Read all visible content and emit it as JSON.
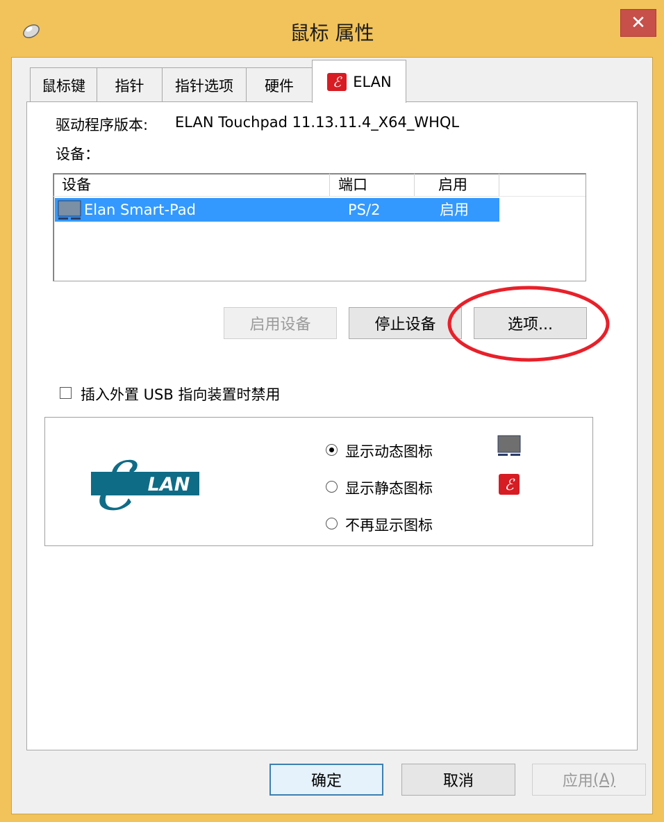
{
  "window": {
    "title": "鼠标 属性",
    "close_symbol": "✕"
  },
  "tabs": [
    {
      "label": "鼠标键"
    },
    {
      "label": "指针"
    },
    {
      "label": "指针选项"
    },
    {
      "label": "硬件"
    },
    {
      "label": "ELAN",
      "active": true
    }
  ],
  "driver": {
    "label": "驱动程序版本:",
    "value": "ELAN Touchpad 11.13.11.4_X64_WHQL"
  },
  "devices_label": "设备：",
  "device_list": {
    "columns": [
      "设备",
      "端口",
      "启用"
    ],
    "rows": [
      {
        "device": "Elan Smart-Pad",
        "port": "PS/2",
        "enabled": "启用",
        "selected": true
      }
    ]
  },
  "device_buttons": {
    "enable": "启用设备",
    "stop": "停止设备",
    "options": "选项..."
  },
  "usb_disable": {
    "label": "插入外置 USB 指向装置时禁用",
    "checked": false
  },
  "icon_options": [
    {
      "label": "显示动态图标",
      "selected": true
    },
    {
      "label": "显示静态图标",
      "selected": false
    },
    {
      "label": "不再显示图标",
      "selected": false
    }
  ],
  "logo": {
    "text": "LAN",
    "color": "#0f6c86"
  },
  "footer": {
    "ok": "确定",
    "cancel": "取消",
    "apply": "应用",
    "apply_mnemonic": "(A)"
  },
  "colors": {
    "titlebar": "#f2c35a",
    "selection": "#3399ff",
    "close": "#c7504a",
    "annotation": "#e8202a"
  },
  "annotation": "red-ellipse-around-options-button"
}
